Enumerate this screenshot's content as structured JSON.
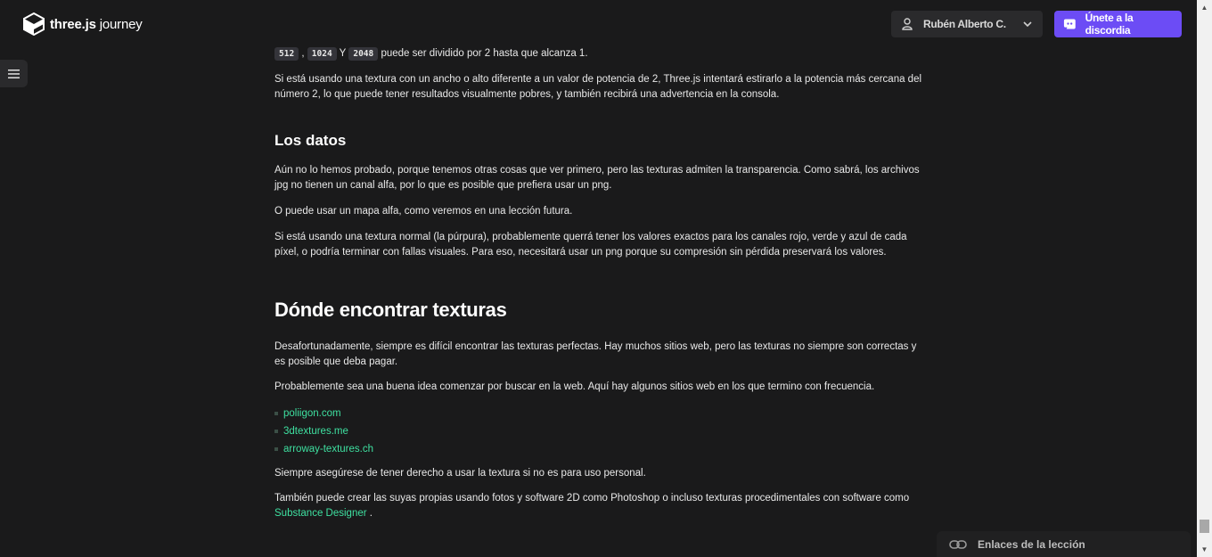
{
  "header": {
    "logo_brand": "three.js",
    "logo_suffix": " journey",
    "user_name": "Rubén Alberto C.",
    "discord_label": "Únete a la discordia"
  },
  "content": {
    "intro": {
      "code1": "512",
      "sep1": ",",
      "code2": "1024",
      "sep2": "Y",
      "code3": "2048",
      "tail": "puede ser dividido por 2 hasta que alcanza 1."
    },
    "p_power": "Si está usando una textura con un ancho o alto diferente a un valor de potencia de 2, Three.js intentará estirarlo a la potencia más cercana del número 2, lo que puede tener resultados visualmente pobres, y también recibirá una advertencia en la consola.",
    "h_data": "Los datos",
    "p_data1": "Aún no lo hemos probado, porque tenemos otras cosas que ver primero, pero las texturas admiten la transparencia. Como sabrá, los archivos jpg no tienen un canal alfa, por lo que es posible que prefiera usar un png.",
    "p_data2": "O puede usar un mapa alfa, como veremos en una lección futura.",
    "p_data3": "Si está usando una textura normal (la púrpura), probablemente querrá tener los valores exactos para los canales rojo, verde y azul de cada píxel, o podría terminar con fallas visuales. Para eso, necesitará usar un png porque su compresión sin pérdida preservará los valores.",
    "h_find": "Dónde encontrar texturas",
    "p_find1": "Desafortunadamente, siempre es difícil encontrar las texturas perfectas. Hay muchos sitios web, pero las texturas no siempre son correctas y es posible que deba pagar.",
    "p_find2": "Probablemente sea una buena idea comenzar por buscar en la web. Aquí hay algunos sitios web en los que termino con frecuencia.",
    "links": [
      "poliigon.com",
      "3dtextures.me",
      "arroway-textures.ch"
    ],
    "p_rights": "Siempre asegúrese de tener derecho a usar la textura si no es para uso personal.",
    "p_own_prefix": "También puede crear las suyas propias usando fotos y software 2D como Photoshop o incluso texturas procedimentales con software como",
    "p_own_link": "Substance Designer",
    "p_own_suffix": "."
  },
  "lesson_links": {
    "label": "Enlaces de la lección"
  },
  "colors": {
    "background": "#1a1a1b",
    "accent_link": "#3ee0a0",
    "discord": "#6c4cf5"
  },
  "icons": {
    "logo": "threejs-cube-logo-icon",
    "user": "user-icon",
    "chevron": "chevron-down-icon",
    "discord": "discord-icon",
    "menu": "hamburger-menu-icon",
    "link": "chain-link-icon"
  }
}
